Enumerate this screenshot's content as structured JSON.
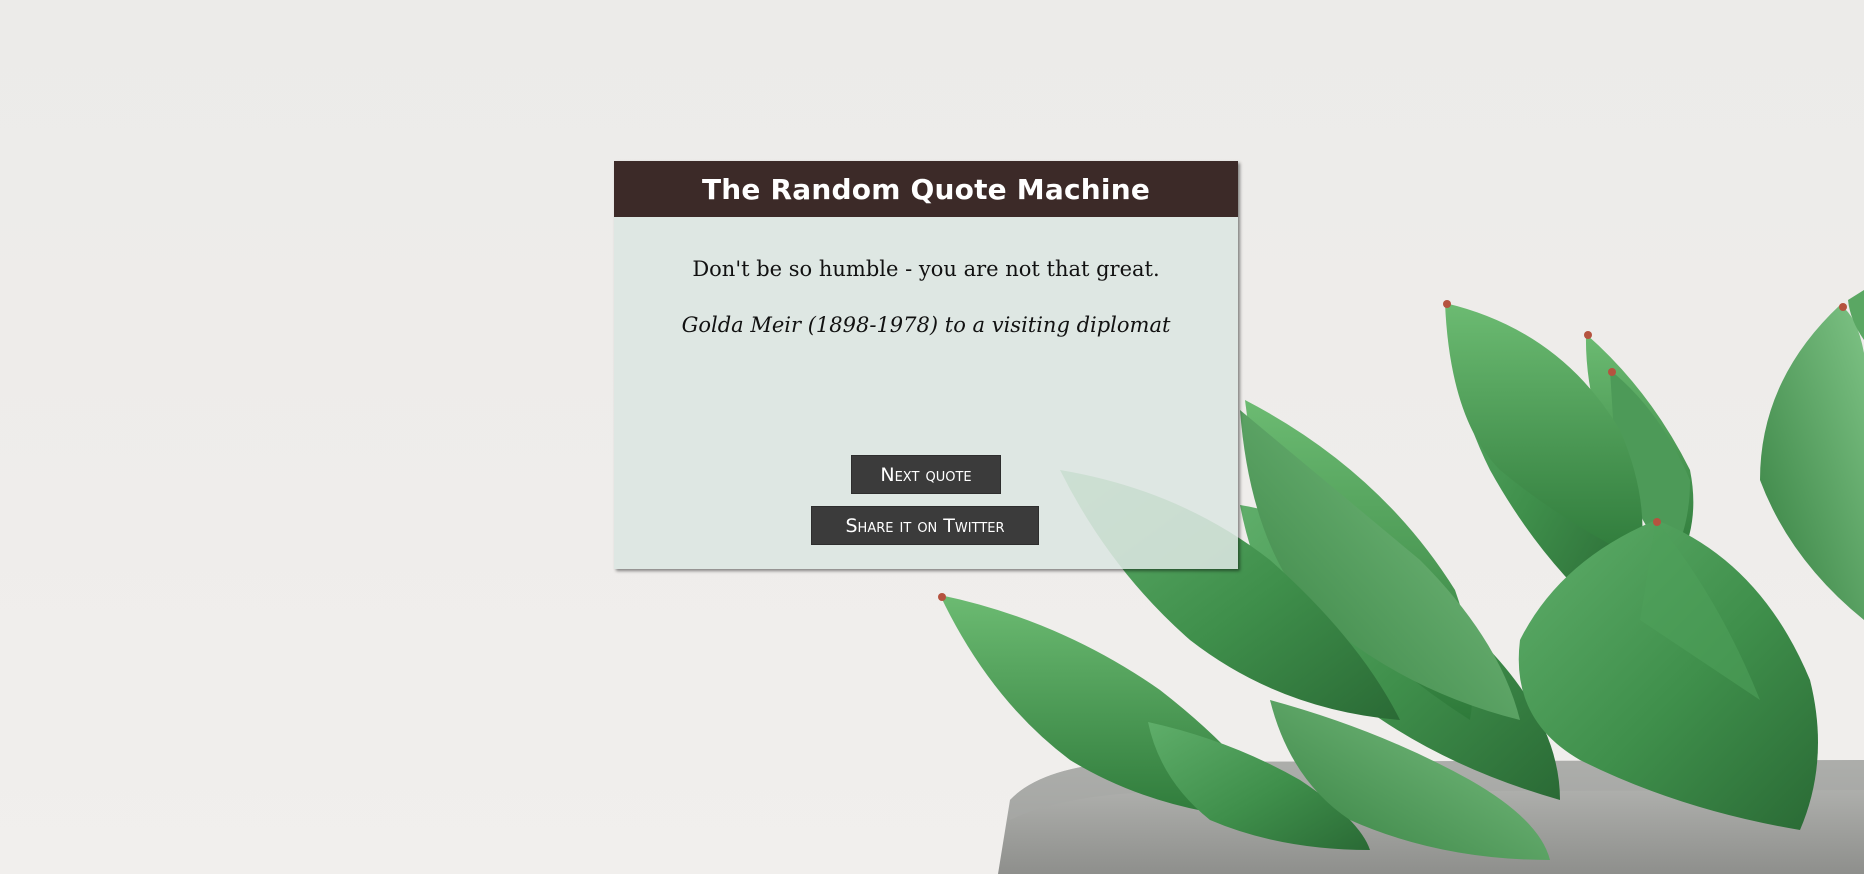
{
  "app": {
    "title": "The Random Quote Machine"
  },
  "quote": {
    "text": "Don't be so humble - you are not that great.",
    "author": "Golda Meir (1898-1978) to a visiting diplomat"
  },
  "buttons": {
    "next_label": "Next quote",
    "tweet_label": "Share it on Twitter"
  },
  "colors": {
    "header_bg": "#3c2a28",
    "card_bg": "#dce6e1",
    "button_bg": "#3b3b3b",
    "page_bg": "#eceae8"
  },
  "background": {
    "image_subject": "succulent-plant-in-concrete-pot"
  }
}
